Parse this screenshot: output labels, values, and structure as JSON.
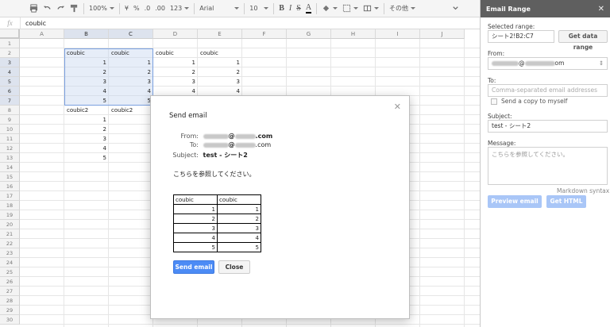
{
  "toolbar": {
    "zoom": "100%",
    "currency": "¥",
    "percent": "%",
    "decimal_decrease": ".0",
    "decimal_increase": ".00",
    "number_format": "123",
    "font": "Arial",
    "font_size": "10",
    "bold": "B",
    "italic": "I",
    "strikethrough": "S",
    "text_color": "A",
    "more": "その他"
  },
  "formula_bar": {
    "fx": "fx",
    "value": "coubic"
  },
  "grid": {
    "columns": [
      "A",
      "B",
      "C",
      "D",
      "E",
      "F",
      "G",
      "H",
      "I",
      "J"
    ],
    "rows": [
      "1",
      "2",
      "3",
      "4",
      "5",
      "6",
      "7",
      "8",
      "9",
      "10",
      "11",
      "12",
      "13",
      "14",
      "15",
      "16",
      "17",
      "18",
      "19",
      "20",
      "21",
      "22",
      "23",
      "24",
      "25",
      "26",
      "27",
      "28",
      "29",
      "30"
    ],
    "cells": {
      "B2": "coubic",
      "C2": "coubic",
      "D2": "coubic",
      "E2": "coubic",
      "B3": "1",
      "C3": "1",
      "D3": "1",
      "E3": "1",
      "B4": "2",
      "C4": "2",
      "D4": "2",
      "E4": "2",
      "B5": "3",
      "C5": "3",
      "D5": "3",
      "E5": "3",
      "B6": "4",
      "C6": "4",
      "D6": "4",
      "E6": "4",
      "B7": "5",
      "C7": "5",
      "B8": "coubic2",
      "C8": "coubic2",
      "B9": "1",
      "B10": "2",
      "B11": "3",
      "B12": "4",
      "B13": "5"
    }
  },
  "sidebar": {
    "title": "Email Range",
    "selected_range_label": "Selected range:",
    "selected_range_value": "シート2!B2:C7",
    "get_data_range": "Get data range",
    "from_label": "From:",
    "from_suffix": "@",
    "from_domain": "om",
    "to_label": "To:",
    "to_placeholder": "Comma-separated email addresses",
    "send_copy_label": "Send a copy to myself",
    "subject_label": "Subject:",
    "subject_value": "test - シート2",
    "message_label": "Message:",
    "message_placeholder": "こちらを参照してください。",
    "markdown_syntax": "Markdown syntax",
    "preview_email": "Preview email",
    "get_html": "Get HTML"
  },
  "modal": {
    "title": "Send email",
    "from_label": "From:",
    "from_at": "@",
    "from_domain": ".com",
    "to_label": "To:",
    "to_at": "@",
    "to_domain": ".com",
    "subject_label": "Subject:",
    "subject_value": "test - シート2",
    "body": "こちらを参照してください。",
    "table_headers": [
      "coubic",
      "coubic"
    ],
    "table_rows": [
      [
        "1",
        "1"
      ],
      [
        "2",
        "2"
      ],
      [
        "3",
        "3"
      ],
      [
        "4",
        "4"
      ],
      [
        "5",
        "5"
      ]
    ],
    "send_button": "Send email",
    "close_button": "Close"
  }
}
